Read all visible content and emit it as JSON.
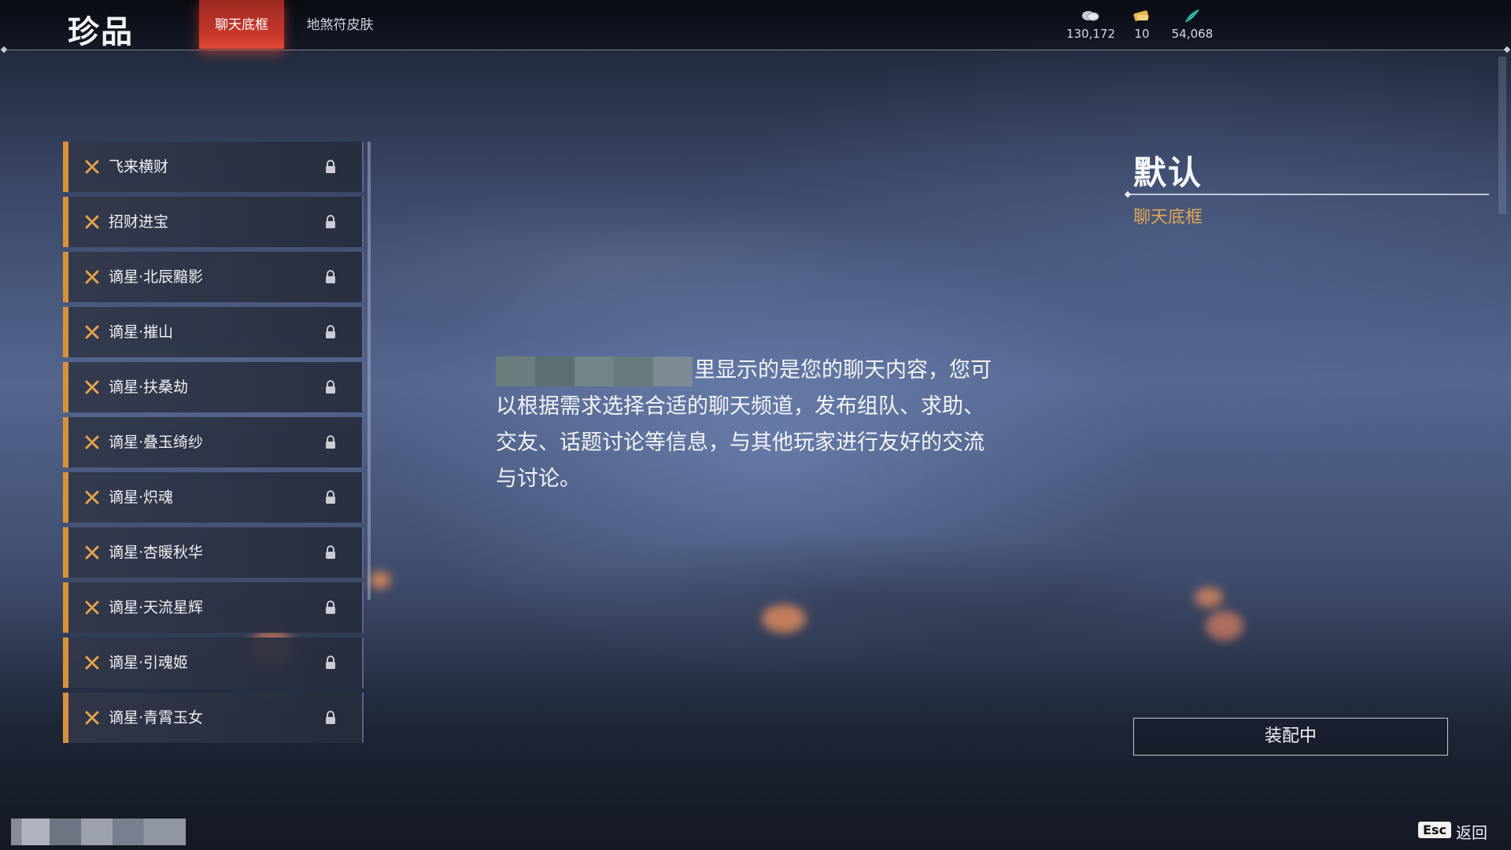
{
  "header": {
    "title": "珍品",
    "tabs": [
      {
        "label": "聊天底框",
        "active": true
      },
      {
        "label": "地煞符皮肤",
        "active": false
      }
    ],
    "currencies": [
      {
        "icon": "silver-coin-icon",
        "value": "130,172"
      },
      {
        "icon": "gold-ticket-icon",
        "value": "10"
      },
      {
        "icon": "jade-feather-icon",
        "value": "54,068"
      }
    ]
  },
  "list": {
    "items": [
      {
        "label": "飞来横财",
        "locked": true
      },
      {
        "label": "招财进宝",
        "locked": true
      },
      {
        "label": "谪星·北辰黯影",
        "locked": true
      },
      {
        "label": "谪星·摧山",
        "locked": true
      },
      {
        "label": "谪星·扶桑劫",
        "locked": true
      },
      {
        "label": "谪星·叠玉绮纱",
        "locked": true
      },
      {
        "label": "谪星·炽魂",
        "locked": true
      },
      {
        "label": "谪星·杏暖秋华",
        "locked": true
      },
      {
        "label": "谪星·天流星辉",
        "locked": true
      },
      {
        "label": "谪星·引魂姬",
        "locked": true
      },
      {
        "label": "谪星·青霄玉女",
        "locked": true
      }
    ]
  },
  "preview": {
    "text": "里显示的是您的聊天内容，您可以根据需求选择合适的聊天频道，发布组队、求助、交友、话题讨论等信息，与其他玩家进行友好的交流与讨论。"
  },
  "selected": {
    "title": "默认",
    "subtitle": "聊天底框",
    "equip_label": "装配中"
  },
  "footer": {
    "esc_key": "Esc",
    "back_label": "返回"
  },
  "colors": {
    "accent_red": "#c9372a",
    "accent_orange": "#d8913e",
    "subtitle_gold": "#e2a754"
  }
}
